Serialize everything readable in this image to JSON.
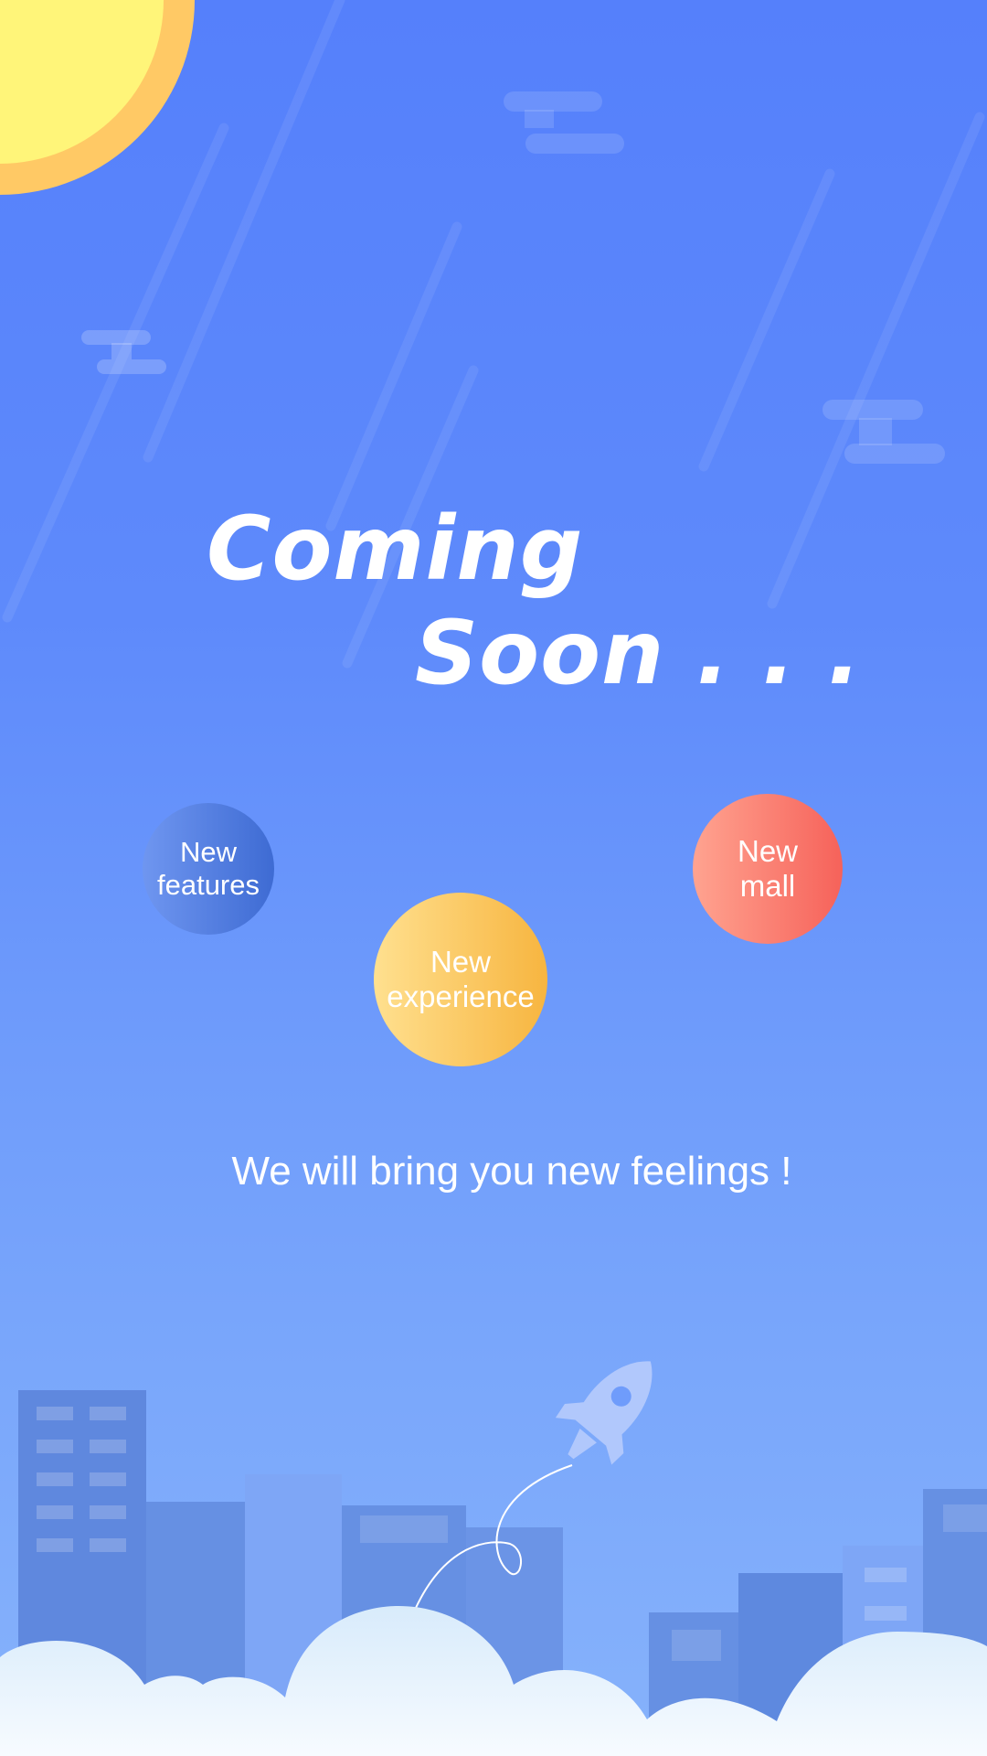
{
  "headline": {
    "line1": "Coming",
    "line2": "Soon . . ."
  },
  "features": [
    {
      "line1": "New",
      "line2": "features"
    },
    {
      "line1": "New",
      "line2": "experience"
    },
    {
      "line1": "New",
      "line2": "mall"
    }
  ],
  "tagline": "We will bring you new feelings !",
  "icons": [
    "sun-icon",
    "cloud-icon",
    "rocket-icon",
    "city-skyline",
    "ground-clouds"
  ],
  "colors": {
    "sky_top": "#5580fb",
    "sky_bottom": "#86b2fb",
    "sun": "#fff579",
    "sun_ring": "#ffc965",
    "features_bubble": "#4f7ae0",
    "mall_bubble": "#f98374",
    "experience_bubble": "#fbcb66"
  }
}
